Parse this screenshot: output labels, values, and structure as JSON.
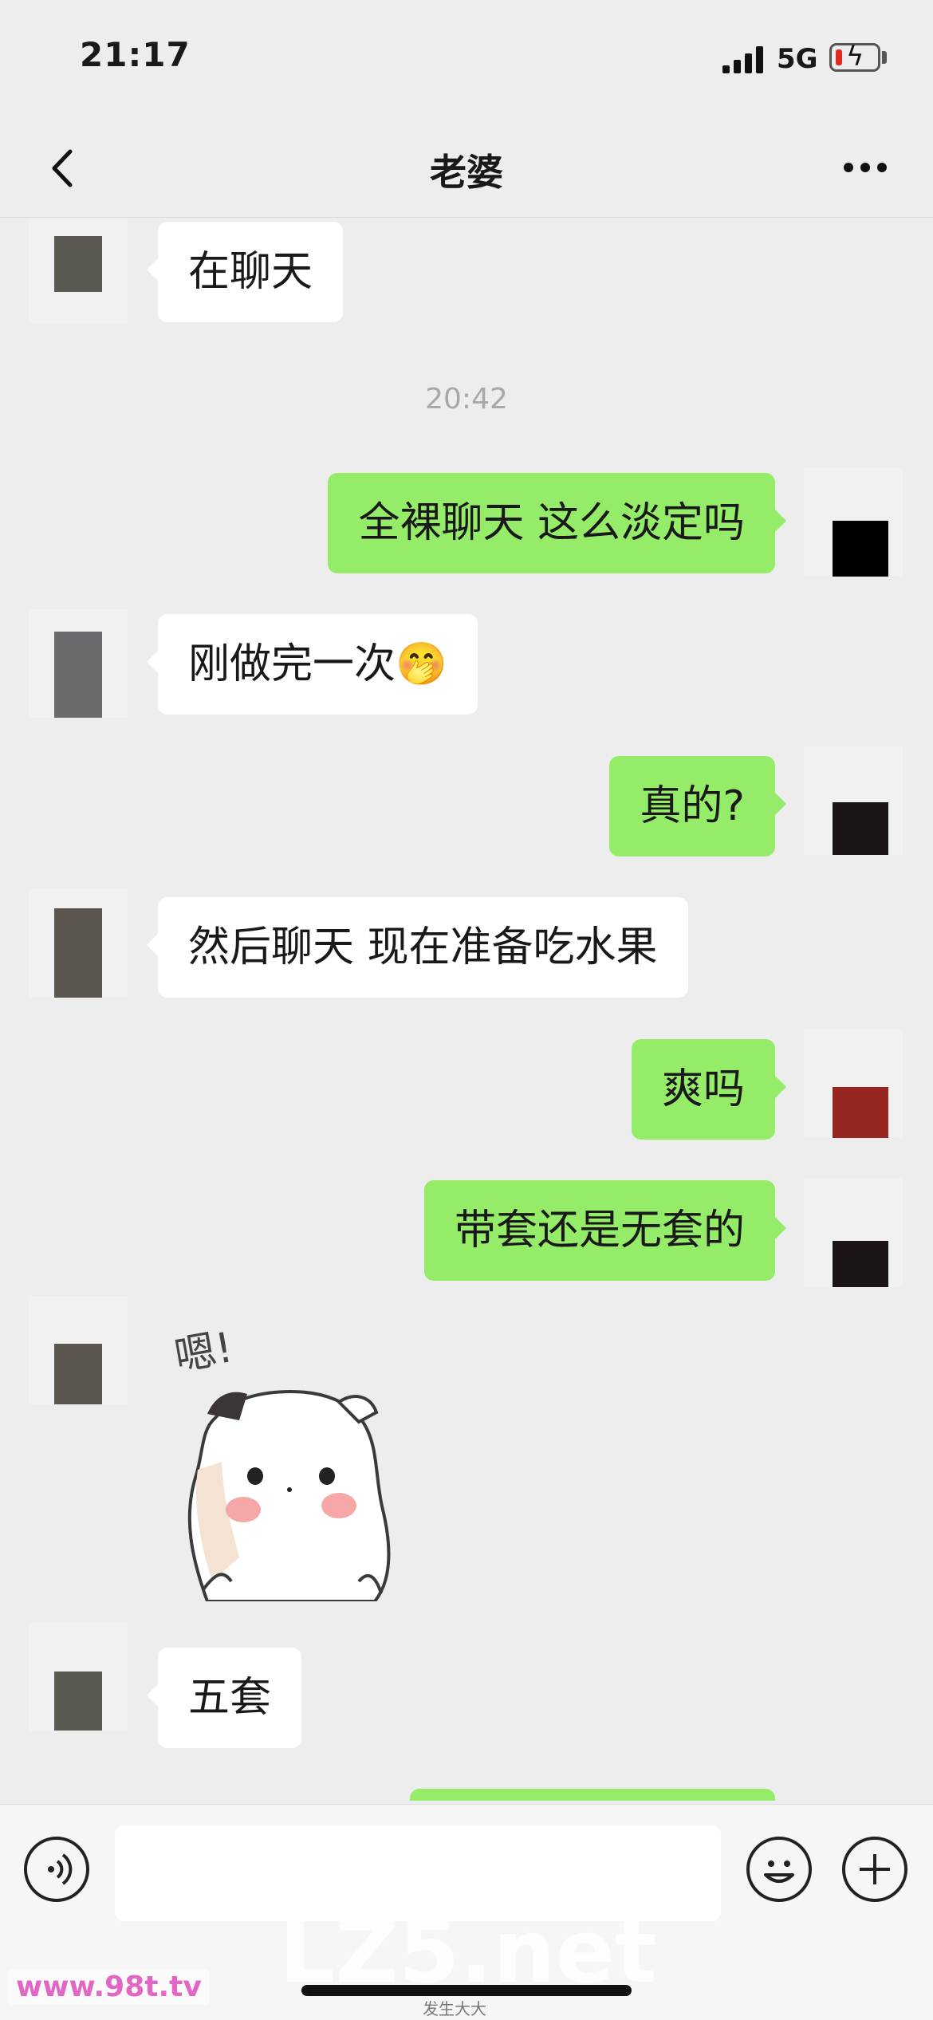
{
  "status_bar": {
    "time": "21:17",
    "network": "5G",
    "battery_icon": "charging-low-battery"
  },
  "header": {
    "title": "老婆",
    "back_icon": "chevron-left-icon",
    "more_icon": "more-dots-icon"
  },
  "messages": [
    {
      "dir": "in",
      "text": "在聊天"
    },
    {
      "timestamp": "20:42"
    },
    {
      "dir": "out",
      "text": "全裸聊天 这么淡定吗"
    },
    {
      "dir": "in",
      "text": "刚做完一次🤭"
    },
    {
      "dir": "out",
      "text": "真的?"
    },
    {
      "dir": "in",
      "text": "然后聊天 现在准备吃水果"
    },
    {
      "dir": "out",
      "text": "爽吗"
    },
    {
      "dir": "out",
      "text": "带套还是无套的"
    },
    {
      "dir": "in",
      "sticker_text": "嗯!"
    },
    {
      "dir": "in",
      "text": "五套"
    }
  ],
  "input_bar": {
    "placeholder": "",
    "voice_icon": "voice-icon",
    "emoji_icon": "emoji-icon",
    "plus_icon": "plus-icon"
  },
  "watermarks": {
    "main": "LZ5.net",
    "corner": "www.98t.tv",
    "bottom": "发生大大"
  },
  "colors": {
    "background": "#ededed",
    "outgoing_bubble": "#95ec69",
    "incoming_bubble": "#ffffff"
  }
}
